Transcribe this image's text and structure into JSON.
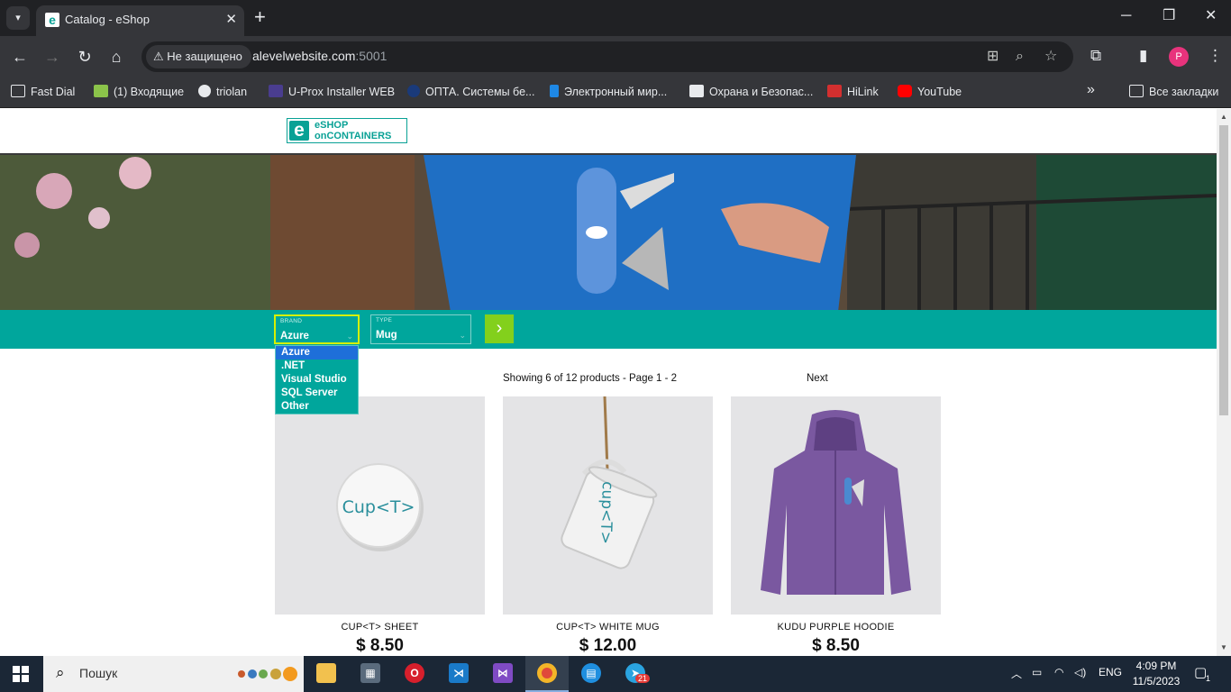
{
  "browser": {
    "tab_title": "Catalog - eShop",
    "security_label": "Не защищено",
    "url_host": "alevelwebsite.com",
    "url_port": ":5001",
    "profile_initial": "P",
    "bookmarks": [
      "Fast Dial",
      "(1) Входящие",
      "triolan",
      "U-Prox Installer WEB",
      "ОПТА. Системы бе...",
      "Электронный мир...",
      "Охрана и Безопас...",
      "HiLink",
      "YouTube"
    ],
    "all_bookmarks": "Все закладки"
  },
  "site": {
    "logo_line1": "eSHOP",
    "logo_line2": "onCONTAINERS",
    "brand_filter": {
      "label": "BRAND",
      "value": "Azure"
    },
    "type_filter": {
      "label": "TYPE",
      "value": "Mug"
    },
    "brand_options": [
      "Azure",
      ".NET",
      "Visual Studio",
      "SQL Server",
      "Other"
    ],
    "pager_info": "Showing 6 of 12 products - Page 1 - 2",
    "pager_next": "Next",
    "products": [
      {
        "name": "CUP<T> SHEET",
        "price": "$ 8.50",
        "image_text": "Cup<T>"
      },
      {
        "name": "CUP<T> WHITE MUG",
        "price": "$ 12.00",
        "image_text": "cup<T>"
      },
      {
        "name": "KUDU PURPLE HOODIE",
        "price": "$ 8.50"
      }
    ]
  },
  "taskbar": {
    "search_placeholder": "Пошук",
    "lang": "ENG",
    "time": "4:09 PM",
    "date": "11/5/2023",
    "notification_count": "1",
    "telegram_badge": "21"
  },
  "colors": {
    "accent": "#00a69c",
    "go_button": "#83d01c",
    "dropdown_selected": "#1e6fd9"
  }
}
